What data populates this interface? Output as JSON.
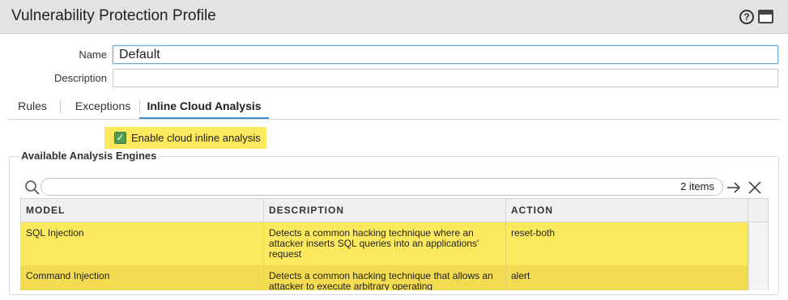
{
  "window": {
    "title": "Vulnerability Protection Profile",
    "help_icon": "question-circle-icon",
    "window_icon": "maximize-window-icon"
  },
  "form": {
    "name_label": "Name",
    "name_value": "Default",
    "description_label": "Description",
    "description_value": ""
  },
  "tabs": [
    {
      "label": "Rules",
      "active": false
    },
    {
      "label": "Exceptions",
      "active": false
    },
    {
      "label": "Inline Cloud Analysis",
      "active": true
    }
  ],
  "cloud_analysis": {
    "enable_label": "Enable cloud inline analysis",
    "enabled": true,
    "highlight_color": "#fde95e"
  },
  "engines": {
    "legend": "Available Analysis Engines",
    "search_placeholder": "",
    "items_count": "2 items",
    "columns": [
      "MODEL",
      "DESCRIPTION",
      "ACTION"
    ],
    "rows": [
      {
        "model": "SQL Injection",
        "description": "Detects a common hacking technique where an attacker inserts SQL queries into an applications' request",
        "action": "reset-both"
      },
      {
        "model": "Command Injection",
        "description": "Detects a common hacking technique that allows an attacker to execute arbitrary operating",
        "action": "alert"
      }
    ]
  }
}
